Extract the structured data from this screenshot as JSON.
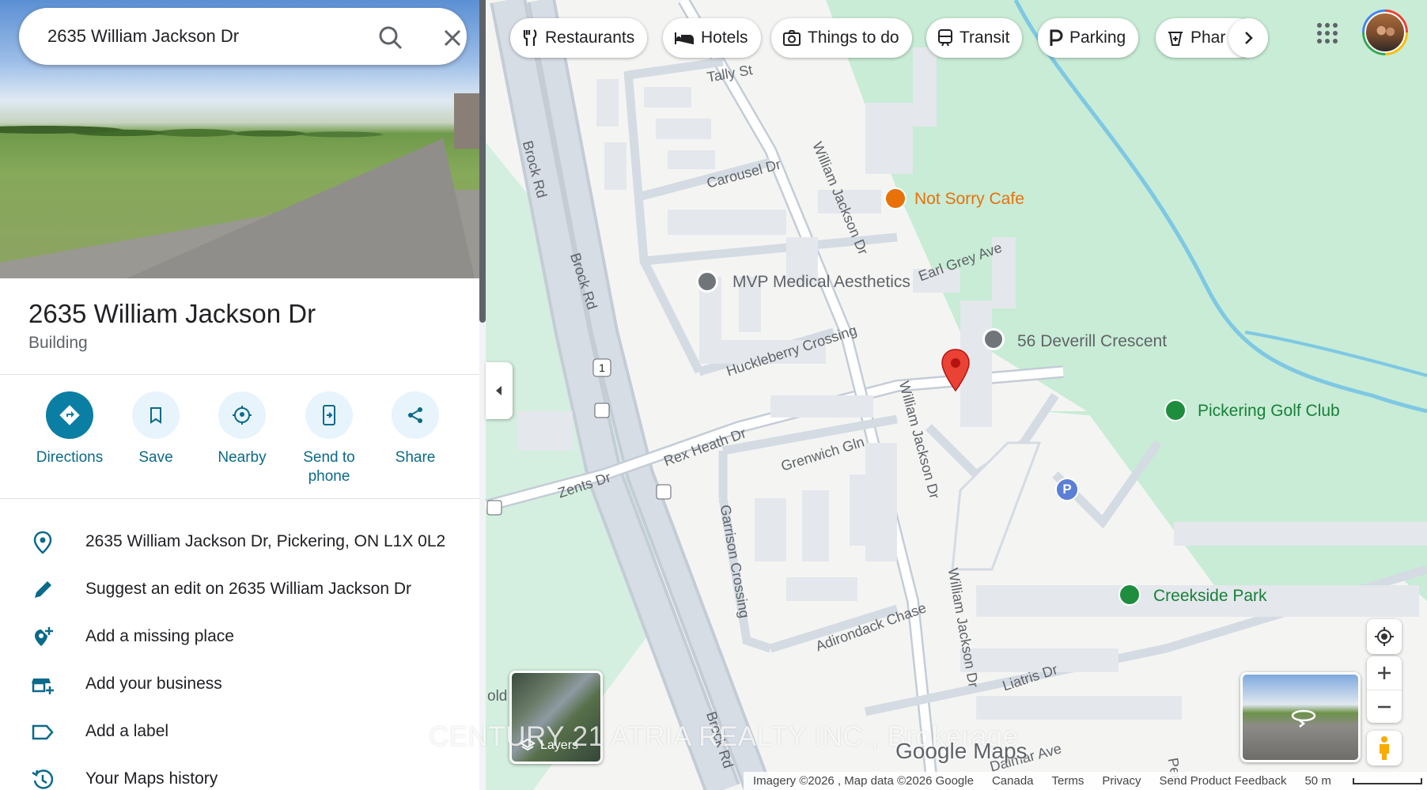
{
  "search": {
    "value": "2635 William Jackson Dr"
  },
  "place": {
    "title": "2635 William Jackson Dr",
    "type": "Building"
  },
  "actions": [
    {
      "label": "Directions"
    },
    {
      "label": "Save"
    },
    {
      "label": "Nearby"
    },
    {
      "label": "Send to phone"
    },
    {
      "label": "Share"
    }
  ],
  "info_rows": [
    {
      "icon": "location-pin-icon",
      "text": "2635 William Jackson Dr, Pickering, ON L1X 0L2"
    },
    {
      "icon": "pencil-icon",
      "text": "Suggest an edit on 2635 William Jackson Dr"
    },
    {
      "icon": "add-place-icon",
      "text": "Add a missing place"
    },
    {
      "icon": "add-business-icon",
      "text": "Add your business"
    },
    {
      "icon": "label-icon",
      "text": "Add a label"
    },
    {
      "icon": "history-icon",
      "text": "Your Maps history"
    }
  ],
  "chips": [
    {
      "icon": "fork-knife-icon",
      "label": "Restaurants"
    },
    {
      "icon": "bed-icon",
      "label": "Hotels"
    },
    {
      "icon": "camera-icon",
      "label": "Things to do"
    },
    {
      "icon": "train-icon",
      "label": "Transit"
    },
    {
      "icon": "parking-icon",
      "label": "Parking"
    },
    {
      "icon": "pharmacy-icon",
      "label": "Phar"
    }
  ],
  "map": {
    "places": [
      {
        "name": "Not Sorry Cafe",
        "color": "#e8710a"
      },
      {
        "name": "MVP Medical Aesthetics",
        "color": "#5f6368"
      },
      {
        "name": "56 Deverill Crescent",
        "color": "#5f6368"
      },
      {
        "name": "Pickering Golf Club",
        "color": "#188038"
      },
      {
        "name": "Creekside Park",
        "color": "#188038"
      }
    ],
    "roads": [
      "Tally St",
      "Carousel Dr",
      "William Jackson Dr",
      "Earl Grey Ave",
      "Huckleberry Crossing",
      "Brock Rd",
      "Rex Heath Dr",
      "Grenwich Gln",
      "Zents Dr",
      "Garrison Crossing",
      "Adirondack Chase",
      "Liatris Dr",
      "Dalmar Ave",
      "Peri",
      "Brock Rd",
      "William Jackson Dr",
      "William Jackson Dr",
      "Brock Rd"
    ],
    "route_shield": "1",
    "parking_letter": "P",
    "cut_text": "old"
  },
  "layers_label": "Layers",
  "watermark": "CENTURY 21 ATRIA REALTY INC., Brokerage",
  "google_logo": "Google Maps",
  "attribution": {
    "imagery": "Imagery ©2026 , Map data ©2026 Google",
    "country": "Canada",
    "terms": "Terms",
    "privacy": "Privacy",
    "feedback": "Send Product Feedback",
    "scale": "50 m"
  },
  "colors": {
    "accent": "#0b7ea3",
    "park": "#c8ecd6",
    "water": "#7ec8e3",
    "pin": "#ea4335"
  }
}
